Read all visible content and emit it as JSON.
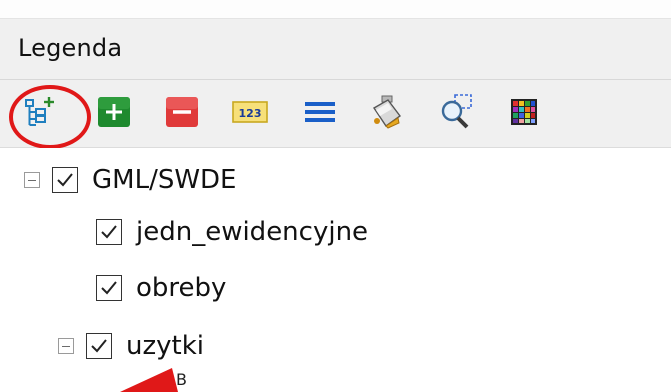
{
  "panel": {
    "title": "Legenda"
  },
  "toolbar": {
    "buttons": [
      {
        "icon": "add-group-tree-icon"
      },
      {
        "icon": "add-layer-plus-icon"
      },
      {
        "icon": "remove-layer-minus-icon"
      },
      {
        "icon": "numbering-123-icon",
        "text": "123"
      },
      {
        "icon": "list-lines-icon"
      },
      {
        "icon": "paint-bucket-style-icon"
      },
      {
        "icon": "zoom-selection-icon"
      },
      {
        "icon": "color-palette-icon"
      }
    ]
  },
  "tree": {
    "items": [
      {
        "label": "GML/SWDE",
        "checked": true,
        "expanded": true,
        "level": 0
      },
      {
        "label": "jedn_ewidencyjne",
        "checked": true,
        "level": 1
      },
      {
        "label": "obreby",
        "checked": true,
        "level": 1
      },
      {
        "label": "uzytki",
        "checked": true,
        "expanded": true,
        "level": 1
      },
      {
        "label": "B",
        "level": 2
      }
    ]
  },
  "colors": {
    "highlight": "#e01818",
    "add_green": "#1e8a2e",
    "remove_red": "#e03a3a",
    "list_blue": "#1a5fc8"
  }
}
